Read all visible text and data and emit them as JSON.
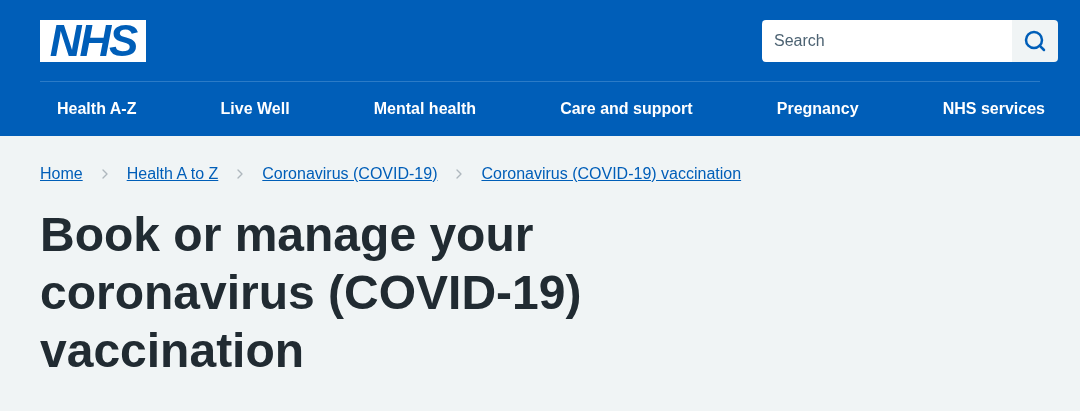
{
  "header": {
    "logo": "NHS",
    "search": {
      "placeholder": "Search"
    }
  },
  "nav": [
    "Health A-Z",
    "Live Well",
    "Mental health",
    "Care and support",
    "Pregnancy",
    "NHS services"
  ],
  "breadcrumbs": [
    "Home",
    "Health A to Z",
    "Coronavirus (COVID-19)",
    "Coronavirus (COVID-19) vaccination"
  ],
  "title": "Book or manage your coronavirus (COVID-19) vaccination"
}
